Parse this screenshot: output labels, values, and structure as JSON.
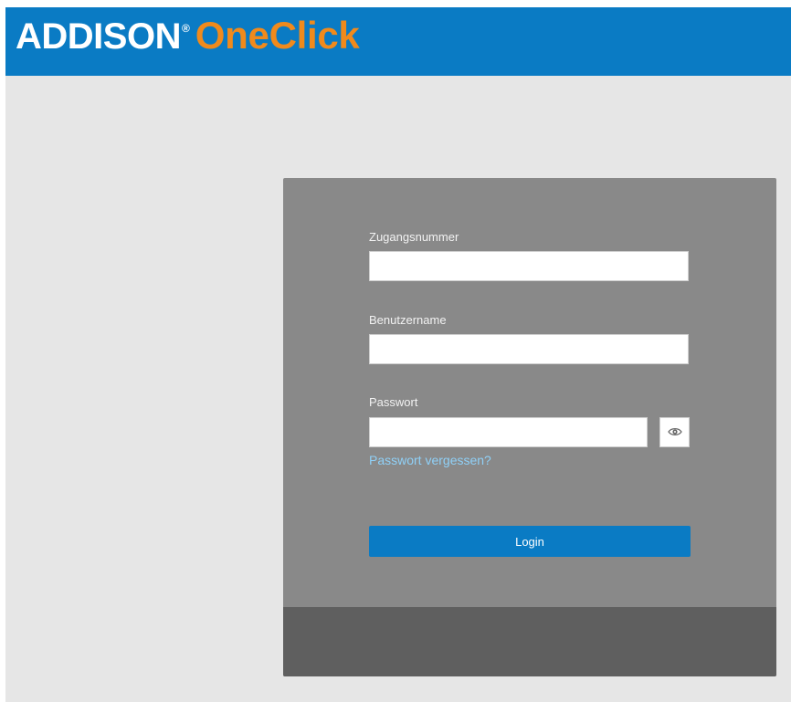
{
  "header": {
    "brand": "ADDISON",
    "registered_mark": "®",
    "product": "OneClick"
  },
  "login": {
    "access_number_label": "Zugangsnummer",
    "access_number_value": "",
    "username_label": "Benutzername",
    "username_value": "",
    "password_label": "Passwort",
    "password_value": "",
    "show_password_icon": "eye-icon",
    "forgot_password_link": "Passwort vergessen?",
    "login_button": "Login"
  },
  "colors": {
    "header_blue": "#0a7bc4",
    "brand_orange": "#f08a1c",
    "panel_gray": "#898989",
    "footer_gray": "#5f5f5f",
    "page_background": "#e6e6e6",
    "link_blue": "#8fd0f7"
  }
}
